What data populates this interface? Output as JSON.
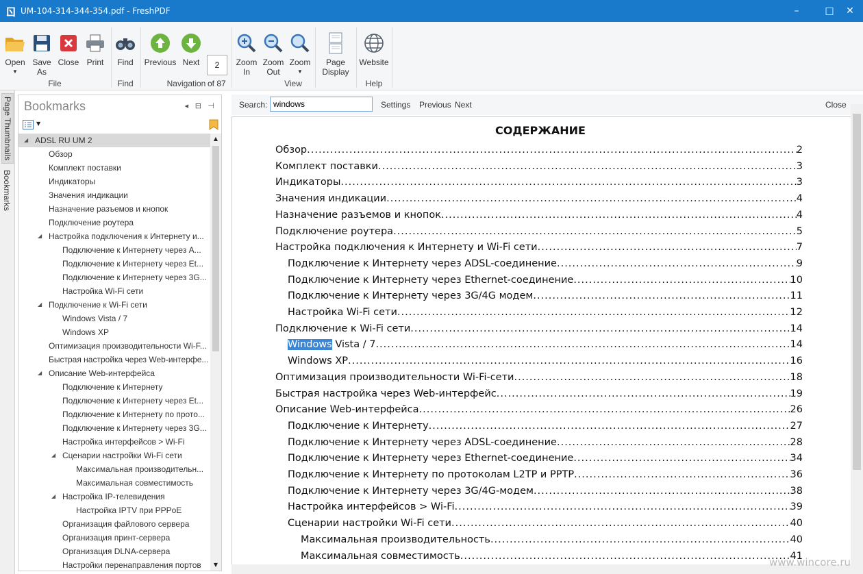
{
  "window": {
    "logo_glyph": "ㄖ",
    "title": "UM-104-314-344-354.pdf - FreshPDF",
    "min_icon": "–",
    "max_icon": "□",
    "close_icon": "✕"
  },
  "ribbon": {
    "open": "Open",
    "save_as": "Save As",
    "close": "Close",
    "print": "Print",
    "find": "Find",
    "previous": "Previous",
    "next": "Next",
    "page_number": "2",
    "of_pages": "of 87",
    "zoom_in": "Zoom In",
    "zoom_out": "Zoom Out",
    "zoom": "Zoom",
    "page_display": "Page Display",
    "website": "Website",
    "groups": {
      "file": "File",
      "find": "Find",
      "navigation": "Navigation",
      "view": "View",
      "help": "Help"
    }
  },
  "side_tabs": {
    "thumbnails": "Page Thumbnails",
    "bookmarks": "Bookmarks"
  },
  "bookmarks": {
    "title": "Bookmarks",
    "items": [
      {
        "label": "ADSL RU UM 2",
        "level": 0,
        "expanded": true,
        "selected": true
      },
      {
        "label": "Обзор",
        "level": 1
      },
      {
        "label": "Комплект поставки",
        "level": 1
      },
      {
        "label": "Индикаторы",
        "level": 1
      },
      {
        "label": "Значения индикации",
        "level": 1
      },
      {
        "label": "Назначение разъемов и кнопок",
        "level": 1
      },
      {
        "label": "Подключение роутера",
        "level": 1
      },
      {
        "label": "Настройка подключения к Интернету и...",
        "level": 1,
        "expanded": true
      },
      {
        "label": "Подключение к Интернету через A...",
        "level": 2
      },
      {
        "label": "Подключение к Интернету через Et...",
        "level": 2
      },
      {
        "label": "Подключение к Интернету через 3G...",
        "level": 2
      },
      {
        "label": "Настройка Wi-Fi сети",
        "level": 2
      },
      {
        "label": "Подключение к Wi-Fi сети",
        "level": 1,
        "expanded": true
      },
      {
        "label": "Windows Vista / 7",
        "level": 2
      },
      {
        "label": "Windows XP",
        "level": 2
      },
      {
        "label": "Оптимизация производительности Wi-F...",
        "level": 1
      },
      {
        "label": "Быстрая настройка через Web-интерфе...",
        "level": 1
      },
      {
        "label": "Описание Web-интерфейса",
        "level": 1,
        "expanded": true
      },
      {
        "label": "Подключение к Интернету",
        "level": 2
      },
      {
        "label": "Подключение к Интернету через Et...",
        "level": 2
      },
      {
        "label": "Подключение к Интернету по прото...",
        "level": 2
      },
      {
        "label": "Подключение к Интернету через 3G...",
        "level": 2
      },
      {
        "label": "Настройка интерфейсов > Wi-Fi",
        "level": 2
      },
      {
        "label": "Сценарии настройки Wi-Fi сети",
        "level": 2,
        "expanded": true
      },
      {
        "label": "Максимальная производительн...",
        "level": 3
      },
      {
        "label": "Максимальная совместимость",
        "level": 3
      },
      {
        "label": "Настройка IP-телевидения",
        "level": 2,
        "expanded": true
      },
      {
        "label": "Настройка IPTV при PPPoE",
        "level": 3
      },
      {
        "label": "Организация файлового сервера",
        "level": 2
      },
      {
        "label": "Организация принт-сервера",
        "level": 2
      },
      {
        "label": "Организация DLNA-сервера",
        "level": 2
      },
      {
        "label": "Настройки перенаправления портов",
        "level": 2
      }
    ]
  },
  "search": {
    "label": "Search:",
    "value": "windows",
    "settings": "Settings",
    "previous": "Previous",
    "next": "Next",
    "close": "Close"
  },
  "document": {
    "toc_title": "СОДЕРЖАНИЕ",
    "entries": [
      {
        "text": "Обзор",
        "page": "2",
        "level": 0
      },
      {
        "text": "Комплект поставки",
        "page": "3",
        "level": 0
      },
      {
        "text": "Индикаторы",
        "page": "3",
        "level": 0
      },
      {
        "text": "Значения индикации ",
        "page": "4",
        "level": 0
      },
      {
        "text": "Назначение разъемов и кнопок",
        "page": "4",
        "level": 0
      },
      {
        "text": "Подключение роутера ",
        "page": "5",
        "level": 0
      },
      {
        "text": "Настройка подключения к Интернету и Wi-Fi сети ",
        "page": "7",
        "level": 0
      },
      {
        "text": "Подключение к Интернету через ADSL-соединение ",
        "page": "9",
        "level": 1
      },
      {
        "text": "Подключение к Интернету через Ethernet-соединение",
        "page": "10",
        "level": 1
      },
      {
        "text": "Подключение к Интернету через 3G/4G модем ",
        "page": "11",
        "level": 1
      },
      {
        "text": "Настройка Wi-Fi сети ",
        "page": "12",
        "level": 1
      },
      {
        "text": "Подключение к Wi-Fi сети ",
        "page": "14",
        "level": 0
      },
      {
        "text": "Windows",
        "text_rest": " Vista / 7",
        "page": "14",
        "level": 1,
        "highlight": true
      },
      {
        "text": "Windows XP ",
        "page": "16",
        "level": 1
      },
      {
        "text": "Оптимизация производительности Wi-Fi-сети",
        "page": "18",
        "level": 0
      },
      {
        "text": "Быстрая настройка через Web-интерфейс ",
        "page": "19",
        "level": 0
      },
      {
        "text": "Описание Web-интерфейса",
        "page": "26",
        "level": 0
      },
      {
        "text": "Подключение к Интернету ",
        "page": "27",
        "level": 1
      },
      {
        "text": "Подключение к Интернету через ADSL-соединение ",
        "page": "28",
        "level": 1
      },
      {
        "text": "Подключение к Интернету через Ethernet-соединение ",
        "page": "34",
        "level": 1
      },
      {
        "text": "Подключение к Интернету по протоколам L2TP и PPTP",
        "page": "36",
        "level": 1
      },
      {
        "text": "Подключение к Интернету через 3G/4G-модем ",
        "page": "38",
        "level": 1
      },
      {
        "text": "Настройка интерфейсов > Wi-Fi",
        "page": "39",
        "level": 1
      },
      {
        "text": "Сценарии настройки Wi-Fi сети ",
        "page": "40",
        "level": 1
      },
      {
        "text": "Максимальная производительность ",
        "page": "40",
        "level": 2
      },
      {
        "text": "Максимальная совместимость ",
        "page": "41",
        "level": 2
      }
    ]
  },
  "watermark": "www.wincore.ru"
}
